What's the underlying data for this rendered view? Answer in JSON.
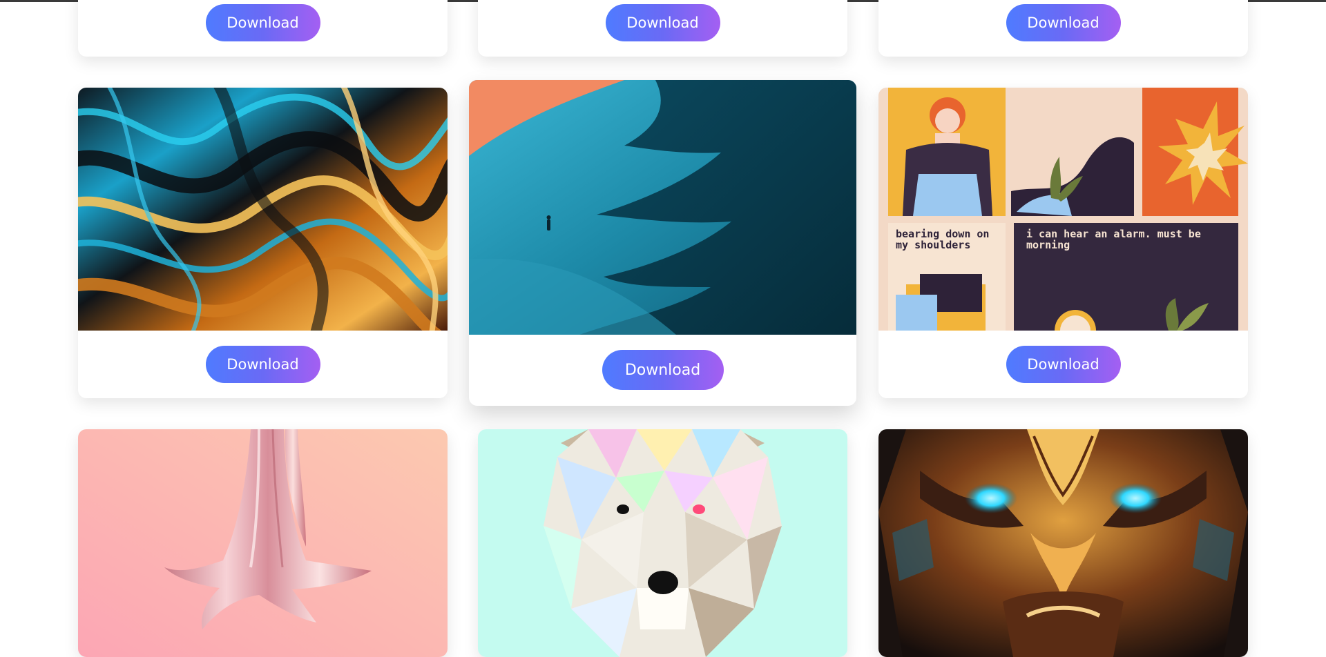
{
  "gallery": {
    "download_label": "Download",
    "row_top": [
      {
        "alt": "wallpaper-top-left"
      },
      {
        "alt": "wallpaper-top-center"
      },
      {
        "alt": "wallpaper-top-right"
      }
    ],
    "row_middle": [
      {
        "alt": "liquid-metal-swirls",
        "colors": [
          "#0e1a22",
          "#1aa0c8",
          "#c46a14",
          "#f2b24a"
        ]
      },
      {
        "alt": "desert-dune-lone-walker",
        "colors": [
          "#f28a62",
          "#1e8aa8",
          "#0b4a60",
          "#062c3a"
        ]
      },
      {
        "alt": "illustrated-comic-panels",
        "colors": [
          "#f2b43a",
          "#efd8c8",
          "#e8642e",
          "#34283e"
        ],
        "panel_texts": [
          "bearing down on my shoulders",
          "i can hear an alarm. must be morning"
        ]
      }
    ],
    "row_bottom": [
      {
        "alt": "pink-liquid-metal-splash",
        "colors": [
          "#fca6b4",
          "#fcc9b0"
        ]
      },
      {
        "alt": "low-poly-polar-bear",
        "colors": [
          "#c4fbf0",
          "#f2efe6"
        ]
      },
      {
        "alt": "golden-mask-glowing-eyes",
        "colors": [
          "#1a1210",
          "#c8802e",
          "#2fd8ff"
        ]
      }
    ]
  }
}
